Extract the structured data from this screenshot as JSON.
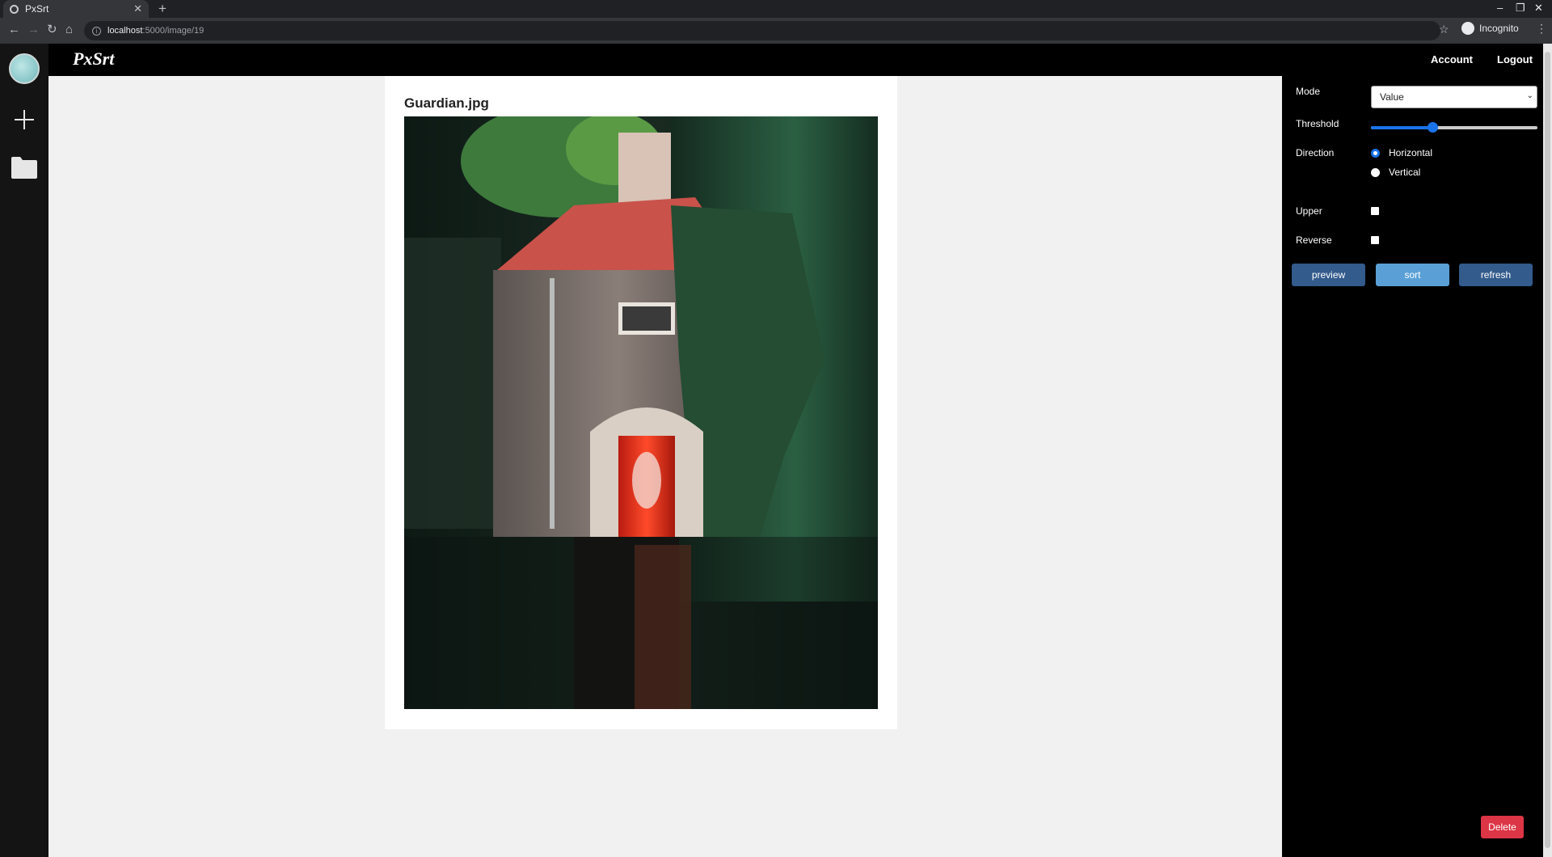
{
  "browser": {
    "tab_title": "PxSrt",
    "url_host": "localhost",
    "url_path": ":5000/image/19",
    "profile_label": "Incognito"
  },
  "app": {
    "brand": "PxSrt",
    "nav": {
      "account": "Account",
      "logout": "Logout"
    }
  },
  "image": {
    "title": "Guardian.jpg"
  },
  "controls": {
    "mode": {
      "label": "Mode",
      "value": "Value"
    },
    "threshold": {
      "label": "Threshold",
      "value_fraction": 0.37
    },
    "direction": {
      "label": "Direction",
      "options": [
        "Horizontal",
        "Vertical"
      ],
      "selected": "Horizontal"
    },
    "upper": {
      "label": "Upper",
      "checked": false
    },
    "reverse": {
      "label": "Reverse",
      "checked": false
    },
    "buttons": {
      "preview": "preview",
      "sort": "sort",
      "refresh": "refresh"
    },
    "delete": "Delete"
  },
  "colors": {
    "button_dark": "#335b8c",
    "button_light": "#5aa0d6",
    "danger": "#dc3545",
    "accent": "#1a73e8"
  }
}
